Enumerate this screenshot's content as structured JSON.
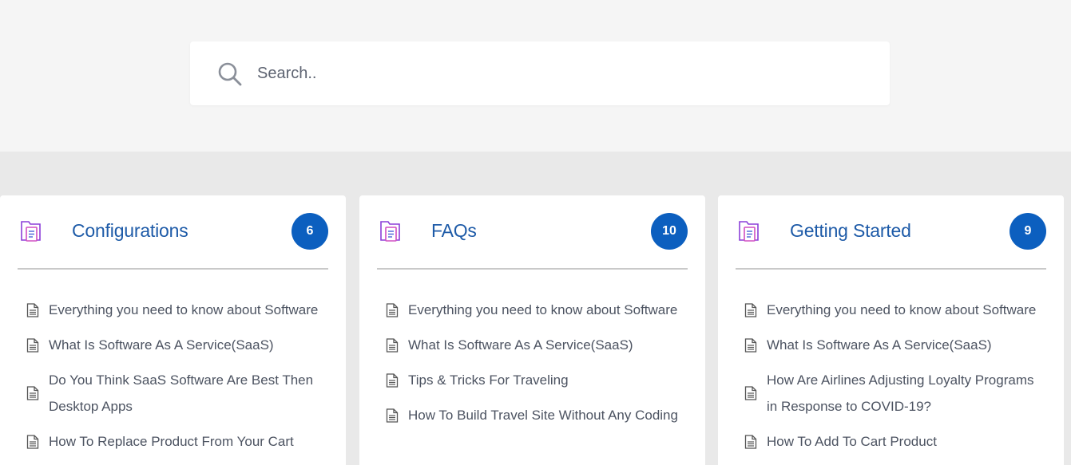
{
  "search": {
    "placeholder": "Search.."
  },
  "icons": {
    "search": "search-icon",
    "category": "folder-document-icon",
    "article": "document-icon"
  },
  "colors": {
    "title": "#1e5ba8",
    "badge": "#0c5fbf",
    "text": "#4c5361",
    "category_icon": "#8b3fd9"
  },
  "categories": [
    {
      "title": "Configurations",
      "count": "6",
      "articles": [
        "Everything you need to know about Software",
        "What Is Software As A Service(SaaS)",
        "Do You Think SaaS Software Are Best Then Desktop Apps",
        "How To Replace Product From Your Cart"
      ]
    },
    {
      "title": "FAQs",
      "count": "10",
      "articles": [
        "Everything you need to know about Software",
        "What Is Software As A Service(SaaS)",
        "Tips & Tricks For Traveling",
        "How To Build Travel Site Without Any Coding"
      ]
    },
    {
      "title": "Getting Started",
      "count": "9",
      "articles": [
        "Everything you need to know about Software",
        "What Is Software As A Service(SaaS)",
        "How Are Airlines Adjusting Loyalty Programs in Response to COVID-19?",
        "How To Add To Cart Product"
      ]
    }
  ]
}
